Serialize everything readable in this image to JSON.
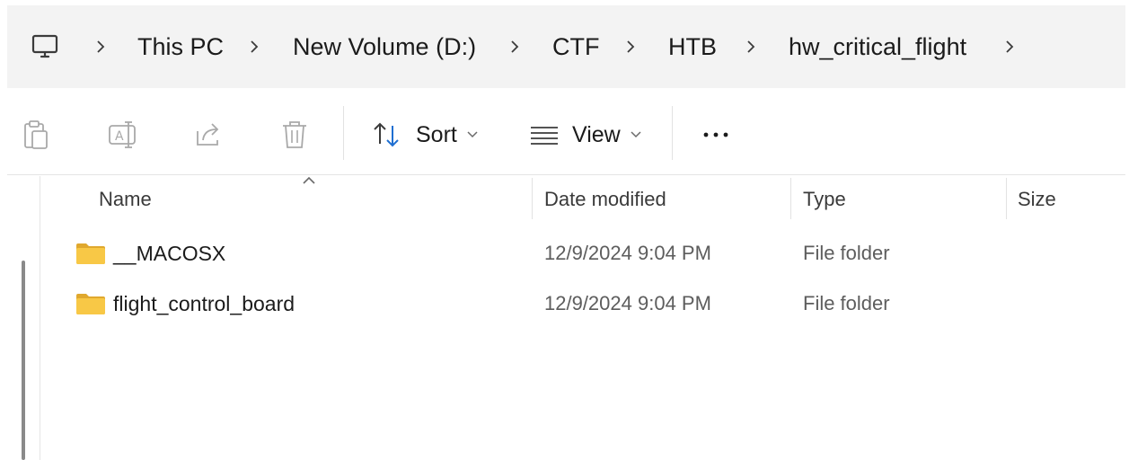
{
  "address_bar": {
    "location_icon": "this-pc-monitor-icon",
    "crumbs": [
      "This PC",
      "New Volume (D:)",
      "CTF",
      "HTB",
      "hw_critical_flight"
    ],
    "separator_icon": "chevron-right-icon"
  },
  "command_bar": {
    "icons": [
      "paste-icon",
      "rename-icon",
      "share-icon",
      "delete-icon"
    ],
    "sort_label": "Sort",
    "view_label": "View",
    "more_icon": "more-options-icon"
  },
  "columns": {
    "name": "Name",
    "date_modified": "Date modified",
    "type": "Type",
    "size": "Size",
    "sorted_by": "Name"
  },
  "rows": [
    {
      "name": "__MACOSX",
      "date_modified": "12/9/2024 9:04 PM",
      "type": "File folder",
      "size": ""
    },
    {
      "name": "flight_control_board",
      "date_modified": "12/9/2024 9:04 PM",
      "type": "File folder",
      "size": ""
    }
  ],
  "colors": {
    "address_bar_bg": "#f3f3f3",
    "folder_yellow": "#f8c846",
    "folder_yellow_dark": "#e0a82e",
    "disabled_icon": "#a9a9a9",
    "text_primary": "#1b1b1b",
    "text_secondary": "#5d5d5d"
  }
}
